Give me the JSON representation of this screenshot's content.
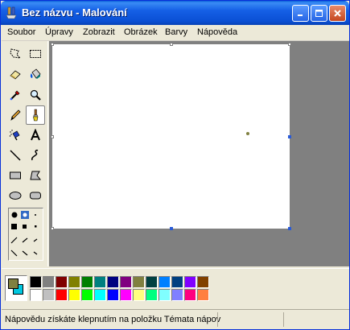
{
  "window": {
    "title": "Bez názvu - Malování",
    "icon": "paint-app-icon",
    "controls": [
      "minimize-icon",
      "maximize-icon",
      "close-icon"
    ]
  },
  "menu": {
    "items": [
      "Soubor",
      "Úpravy",
      "Zobrazit",
      "Obrázek",
      "Barvy",
      "Nápověda"
    ]
  },
  "tools": {
    "items": [
      "free-form-select-icon",
      "rect-select-icon",
      "eraser-icon",
      "fill-bucket-icon",
      "color-picker-icon",
      "magnifier-icon",
      "pencil-icon",
      "brush-icon",
      "airbrush-icon",
      "text-icon",
      "line-icon",
      "curve-icon",
      "rectangle-icon",
      "polygon-icon",
      "ellipse-icon",
      "rounded-rect-icon"
    ],
    "active": "brush-icon"
  },
  "colors": {
    "foreground": "#808040",
    "background": "#00c8e0",
    "palette_top": [
      "#000000",
      "#808080",
      "#800000",
      "#808000",
      "#008000",
      "#008080",
      "#000080",
      "#800080",
      "#808040",
      "#004040",
      "#0080ff",
      "#004080",
      "#8000ff",
      "#804000"
    ],
    "palette_bottom": [
      "#ffffff",
      "#c0c0c0",
      "#ff0000",
      "#ffff00",
      "#00ff00",
      "#00ffff",
      "#0000ff",
      "#ff00ff",
      "#ffff80",
      "#00ff80",
      "#80ffff",
      "#8080ff",
      "#ff0080",
      "#ff8040"
    ]
  },
  "statusbar": {
    "text": "Nápovědu získáte klepnutím na položku Témata nápov"
  }
}
